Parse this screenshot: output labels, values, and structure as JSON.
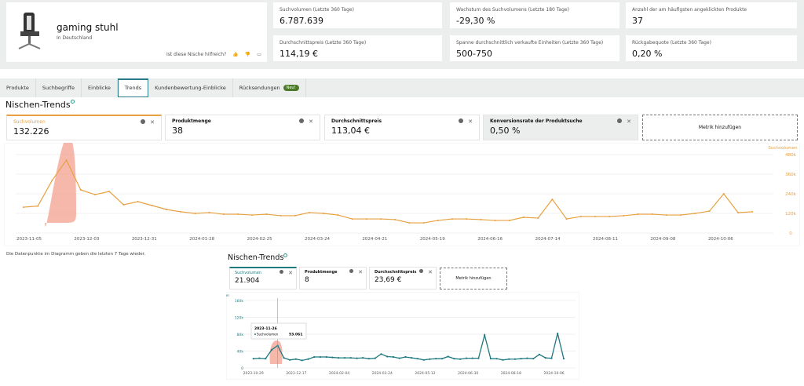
{
  "niche": {
    "name": "gaming stuhl",
    "location": "In Deutschland",
    "help_question": "Ist diese Nische hilfreich?"
  },
  "metrics": [
    {
      "label": "Suchvolumen (Letzte 360 Tage)",
      "value": "6.787.639"
    },
    {
      "label": "Wachstum des Suchvolumens (Letzte 180 Tage)",
      "value": "-29,30 %"
    },
    {
      "label": "Anzahl der am häufigsten angeklickten Produkte",
      "value": "37"
    },
    {
      "label": "Durchschnittspreis (Letzte 360 Tage)",
      "value": "114,19 €"
    },
    {
      "label": "Spanne durchschnittlich verkaufte Einheiten (Letzte 360 Tage)",
      "value": "500-750"
    },
    {
      "label": "Rückgabequote (Letzte 360 Tage)",
      "value": "0,20 %"
    }
  ],
  "tabs": [
    {
      "label": "Produkte"
    },
    {
      "label": "Suchbegriffe"
    },
    {
      "label": "Einblicke"
    },
    {
      "label": "Trends",
      "active": true
    },
    {
      "label": "Kundenbewertung-Einblicke"
    },
    {
      "label": "Rücksendungen",
      "badge": "Neu!"
    }
  ],
  "trends1": {
    "title": "Nischen-Trends",
    "cards": [
      {
        "label": "Suchvolumen",
        "value": "132.226"
      },
      {
        "label": "Produktmenge",
        "value": "38"
      },
      {
        "label": "Durchschnittspreis",
        "value": "113,04 €"
      },
      {
        "label": "Konversionsrate der Produktsuche",
        "value": "0,50 %"
      }
    ],
    "add_metric": "Metrik hinzufügen",
    "note": "Die Datenpunkte im Diagramm geben die letzten 7 Tage wieder."
  },
  "trends2": {
    "title": "Nischen-Trends",
    "cards": [
      {
        "label": "Suchvolumen",
        "value": "21.904"
      },
      {
        "label": "Produktmenge",
        "value": "8"
      },
      {
        "label": "Durchschnittspreis",
        "value": "23,69 €"
      }
    ],
    "add_metric": "Metrik hinzufügen",
    "tooltip": {
      "date": "2023-11-26",
      "series": "Suchvolumen",
      "value": "53.061"
    }
  },
  "colors": {
    "accent_orange": "#e8a040",
    "accent_teal": "#1f7a80",
    "highlight": "#f4a090"
  },
  "chart_data": [
    {
      "type": "line",
      "ylabel": "Suchvolumen",
      "ylim": [
        0,
        480000
      ],
      "yticks": [
        "0",
        "120k",
        "240k",
        "360k",
        "480k"
      ],
      "xticks": [
        "2023-11-05",
        "2023-12-03",
        "2023-12-31",
        "2024-01-28",
        "2024-02-25",
        "2024-03-24",
        "2024-04-21",
        "2024-05-19",
        "2024-06-16",
        "2024-07-14",
        "2024-08-11",
        "2024-09-08",
        "2024-10-06"
      ],
      "x_start": "2023-10-29",
      "x_step_days": 7,
      "values": [
        158000,
        165000,
        322000,
        446000,
        264000,
        235000,
        254000,
        173000,
        192000,
        168000,
        144000,
        130000,
        120000,
        125000,
        115000,
        115000,
        110000,
        115000,
        106000,
        106000,
        125000,
        120000,
        110000,
        86000,
        86000,
        86000,
        82000,
        62000,
        62000,
        77000,
        86000,
        86000,
        82000,
        77000,
        77000,
        96000,
        91000,
        206000,
        86000,
        101000,
        101000,
        101000,
        106000,
        115000,
        115000,
        110000,
        110000,
        120000,
        134000,
        240000,
        125000,
        130000
      ]
    },
    {
      "type": "line",
      "ylabel": "Suchvolumen",
      "ylim": [
        0,
        160000
      ],
      "yticks": [
        "0",
        "40k",
        "80k",
        "120k",
        "160k"
      ],
      "xticks": [
        "2023-10-29",
        "2023-12-17",
        "2024-02-04",
        "2024-03-24",
        "2024-05-12",
        "2024-06-30",
        "2024-08-18",
        "2024-10-06"
      ],
      "x_start": "2023-10-29",
      "x_step_days": 7,
      "values": [
        22000,
        23000,
        22000,
        43000,
        53061,
        24000,
        19000,
        21000,
        18000,
        21000,
        26000,
        26000,
        26000,
        25000,
        24000,
        24000,
        24000,
        23000,
        24000,
        22000,
        23000,
        33000,
        27000,
        26000,
        23000,
        26000,
        24000,
        22000,
        19000,
        21000,
        22000,
        22000,
        27000,
        22000,
        21000,
        23000,
        23000,
        23000,
        78000,
        22000,
        22000,
        19000,
        21000,
        21000,
        22000,
        23000,
        22000,
        32000,
        24000,
        23000,
        82000,
        22000
      ]
    }
  ]
}
